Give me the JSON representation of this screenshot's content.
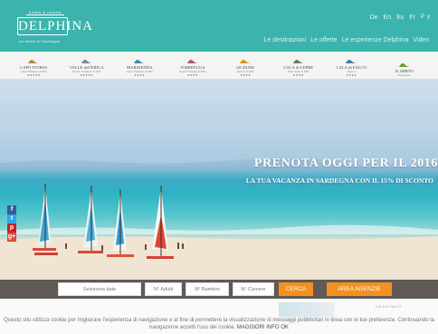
{
  "header": {
    "logo_tagline": "hotels & resorts",
    "logo_name": "DELPHINA",
    "logo_subtitle": "un amico in Sardegna",
    "languages": [
      "De",
      "En",
      "Es",
      "Fr"
    ],
    "social_mini": [
      "P",
      "y"
    ],
    "nav": [
      "Le destinazioni",
      "Le offerte",
      "Le esperienze Delphina",
      "Video"
    ]
  },
  "hotels": [
    {
      "name": "CAPO D'ORSO",
      "sub": "Hotel Thalasso & SPA",
      "stars": "★★★★★",
      "color": "#b98a3e"
    },
    {
      "name": "VALLE dell'ERICA",
      "sub": "Resort Thalasso & SPA",
      "stars": "★★★★★",
      "color": "#7a8a9e"
    },
    {
      "name": "MARINEDDA",
      "sub": "Hotel Thalasso & SPA",
      "stars": "★★★★",
      "color": "#3c8fb3"
    },
    {
      "name": "TORREFUGA",
      "sub": "Hotel Thalasso & SPA",
      "stars": "★★★★",
      "color": "#b5566a"
    },
    {
      "name": "LE DUNE",
      "sub": "Resort & SPA",
      "stars": "★★★★",
      "color": "#e2922c"
    },
    {
      "name": "CALA di LEPRE",
      "sub": "Park Hotel & SPA",
      "stars": "★★★★",
      "color": "#5d8a55"
    },
    {
      "name": "CALA di FALCO",
      "sub": "Resort",
      "stars": "★★★★",
      "color": "#3a7fb0"
    },
    {
      "name": "IL MIRTO",
      "sub": "Residence",
      "stars": "",
      "color": "#6b9a3f"
    }
  ],
  "hero": {
    "title": "PRENOTA OGGI PER IL 2016",
    "subtitle": "LA TUA VACANZA IN SARDEGNA CON IL 15% DI SCONTO"
  },
  "social": [
    "f",
    "t",
    "p",
    "g+"
  ],
  "booking": {
    "date_placeholder": "Seleziona date",
    "adults": "N° Adulti",
    "children": "N° Bambini",
    "rooms": "N° Camere",
    "search": "CERCA",
    "agency": "AREA AGENZIE"
  },
  "bottom": {
    "ghost_logo": "CALA di FALCO"
  },
  "cookie": {
    "text": "Questo sito utilizza cookie per migliorare l'esperienza di navigazione e al fine di permettere la visualizzazione di messaggi pubblicitari in linea con le tue preferenze. Continuando la navigazione accetti l'uso dei cookie.",
    "accept": "MAGGIORI INFO  OK"
  }
}
